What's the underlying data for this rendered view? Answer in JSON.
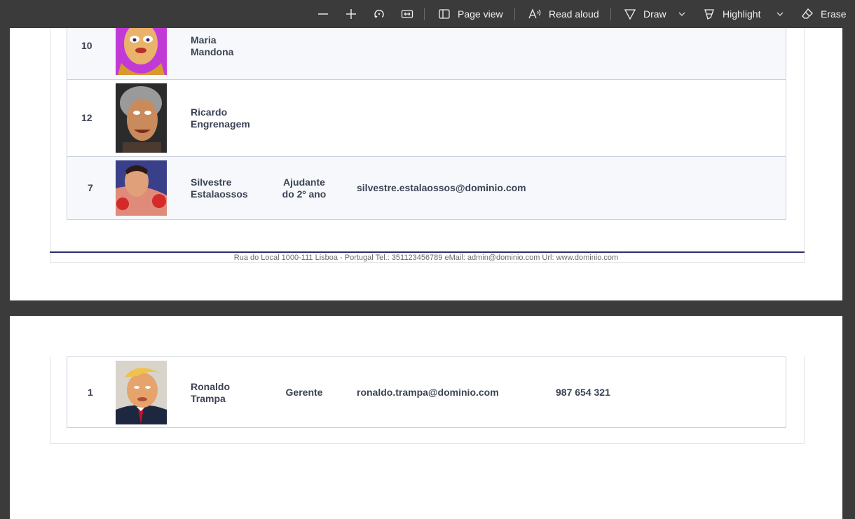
{
  "toolbar": {
    "page_view": "Page view",
    "read_aloud": "Read aloud",
    "draw": "Draw",
    "highlight": "Highlight",
    "erase": "Erase"
  },
  "rows": [
    {
      "id": "10",
      "name_line1": "Maria",
      "name_line2": "Mandona",
      "role_line1": "",
      "role_line2": "",
      "email": "",
      "phone": ""
    },
    {
      "id": "12",
      "name_line1": "Ricardo",
      "name_line2": "Engrenagem",
      "role_line1": "",
      "role_line2": "",
      "email": "",
      "phone": ""
    },
    {
      "id": "7",
      "name_line1": "Silvestre",
      "name_line2": "Estalaossos",
      "role_line1": "Ajudante",
      "role_line2": "do 2º ano",
      "email": "silvestre.estalaossos@dominio.com",
      "phone": ""
    },
    {
      "id": "1",
      "name_line1": "Ronaldo",
      "name_line2": "Trampa",
      "role_line1": "Gerente",
      "role_line2": "",
      "email": "ronaldo.trampa@dominio.com",
      "phone": "987 654 321"
    }
  ],
  "footer": {
    "address": "Rua do Local 1000-111 Lisboa - Portugal Tel.: 351123456789 eMail: admin@dominio.com Url: www.dominio.com"
  },
  "colors": {
    "toolbar_bg": "#3b3b3b",
    "row_text": "#3c4354",
    "footer_rule": "#2c2f6e"
  }
}
